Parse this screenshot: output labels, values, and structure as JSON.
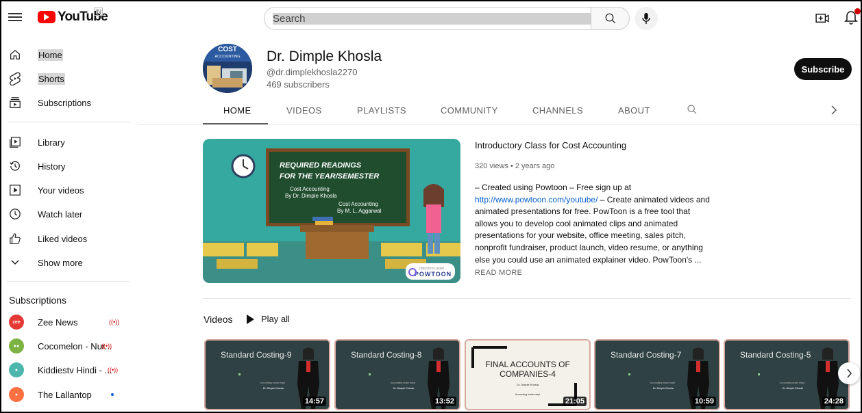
{
  "header": {
    "logo_text": "YouTube",
    "country_code": "IN",
    "search_placeholder": "Search"
  },
  "sidebar": {
    "main": [
      {
        "label": "Home",
        "icon": "home-icon"
      },
      {
        "label": "Shorts",
        "icon": "shorts-icon"
      },
      {
        "label": "Subscriptions",
        "icon": "subscriptions-icon"
      }
    ],
    "library": [
      {
        "label": "Library",
        "icon": "library-icon"
      },
      {
        "label": "History",
        "icon": "history-icon"
      },
      {
        "label": "Your videos",
        "icon": "your-videos-icon"
      },
      {
        "label": "Watch later",
        "icon": "watch-later-icon"
      },
      {
        "label": "Liked videos",
        "icon": "like-icon"
      },
      {
        "label": "Show more",
        "icon": "chevron-down-icon"
      }
    ],
    "subscriptions_heading": "Subscriptions",
    "subscriptions": [
      {
        "label": "Zee News",
        "status": "live",
        "avatar_color": "#e53935"
      },
      {
        "label": "Cocomelon - Nur...",
        "status": "live",
        "avatar_color": "#7cb342"
      },
      {
        "label": "Kiddiestv Hindi - ...",
        "status": "live",
        "avatar_color": "#4db6ac"
      },
      {
        "label": "The Lallantop",
        "status": "new",
        "avatar_color": "#ff7043"
      }
    ]
  },
  "channel": {
    "name": "Dr. Dimple Khosla",
    "handle": "@dr.dimplekhosla2270",
    "subscribers": "469 subscribers",
    "subscribe_label": "Subscribe",
    "avatar_text_1": "COST",
    "avatar_text_2": "ACCOUNTING"
  },
  "tabs": [
    "HOME",
    "VIDEOS",
    "PLAYLISTS",
    "COMMUNITY",
    "CHANNELS",
    "ABOUT"
  ],
  "featured": {
    "title": "Introductory Class for Cost Accounting",
    "meta": "320 views • 2 years ago",
    "desc_before": "– Created using Powtoon – Free sign up at ",
    "desc_link": "http://www.powtoon.com/youtube/",
    "desc_after": " – Create animated videos and animated presentations for free.  PowToon is a free tool that allows you to develop cool animated clips and animated presentations for your website, office meeting, sales pitch, nonprofit fundraiser, product launch, video resume, or anything else you could use an animated explainer video. PowToon's ...",
    "read_more": "READ MORE",
    "board_line1": "REQUIRED READINGS",
    "board_line2": "FOR THE YEAR/SEMESTER",
    "board_book1a": "Cost Accounting",
    "board_book1b": "By Dr. Dimple Khosla",
    "board_book2a": "Cost Accounting",
    "board_book2b": "By M. L. Aggarwal",
    "powtoon_small": "CREATED USING",
    "powtoon_big": "POWTOON"
  },
  "videos_section": {
    "label": "Videos",
    "play_all": "Play all",
    "thumb_small_1": "Accounting made easy!",
    "thumb_small_2": "Dr. Dimple Khosla",
    "items": [
      {
        "title": "Standard Costing-9",
        "duration": "14:57"
      },
      {
        "title": "Standard Costing-8",
        "duration": "13:52"
      },
      {
        "title": "FINAL ACCOUNTS OF COMPANIES-4",
        "title_l1": "FINAL ACCOUNTS OF",
        "title_l2": "COMPANIES-4",
        "duration": "21:05"
      },
      {
        "title": "Standard Costing-7",
        "duration": "10:59"
      },
      {
        "title": "Standard Costing-5",
        "duration": "24:28"
      }
    ]
  }
}
